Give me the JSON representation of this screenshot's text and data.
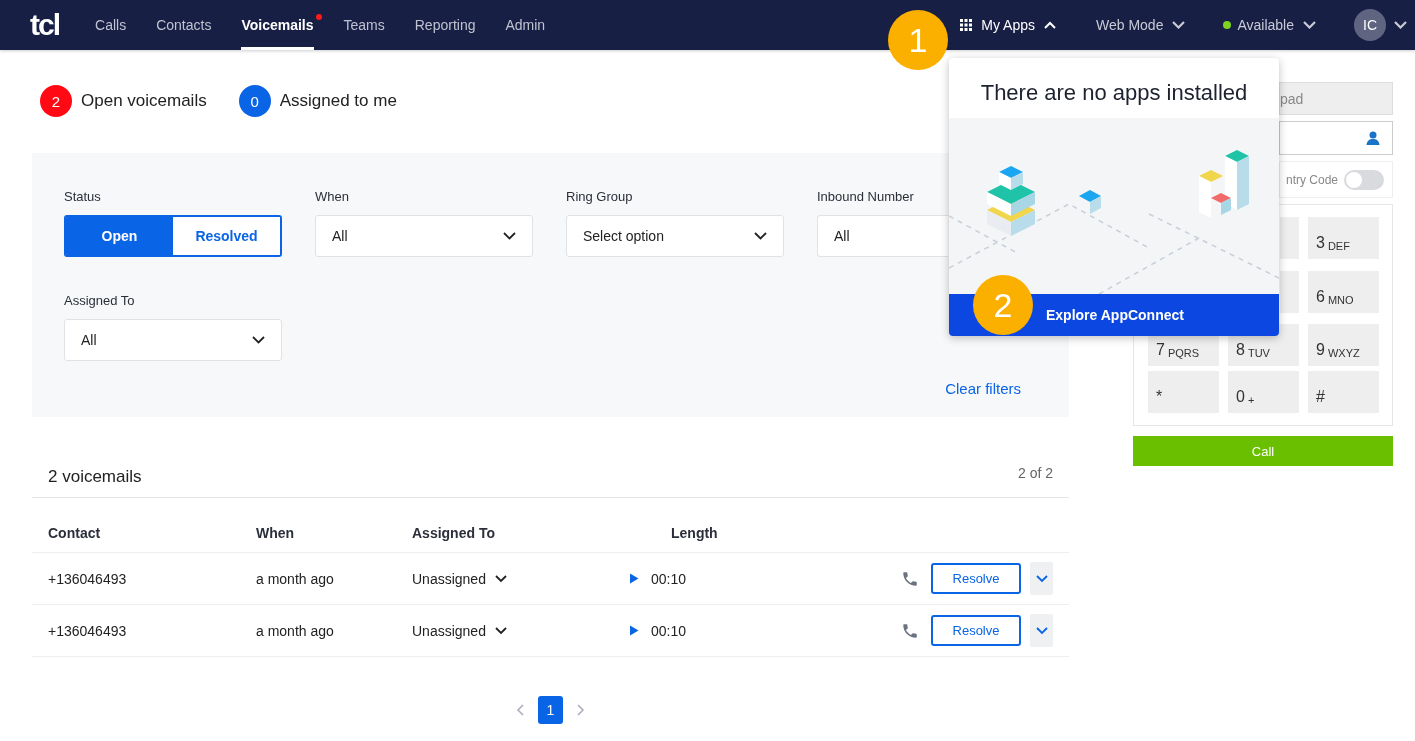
{
  "nav": {
    "logo": "tcl",
    "items": [
      {
        "label": "Calls",
        "selected": false,
        "notification": false
      },
      {
        "label": "Contacts",
        "selected": false,
        "notification": false
      },
      {
        "label": "Voicemails",
        "selected": true,
        "notification": true
      },
      {
        "label": "Teams",
        "selected": false,
        "notification": false
      },
      {
        "label": "Reporting",
        "selected": false,
        "notification": false
      },
      {
        "label": "Admin",
        "selected": false,
        "notification": false
      }
    ],
    "my_apps": {
      "label": "My Apps",
      "expanded": true
    },
    "mode": {
      "label": "Web Mode"
    },
    "status": {
      "label": "Available",
      "color": "#7ed321"
    },
    "avatar": {
      "initials": "IC"
    }
  },
  "stats": [
    {
      "count": "2",
      "label": "Open voicemails",
      "color": "#ff0a14"
    },
    {
      "count": "0",
      "label": "Assigned to me",
      "color": "#0a64e6"
    }
  ],
  "filters": {
    "fields": [
      {
        "kind": "toggle",
        "label": "Status",
        "options": [
          {
            "label": "Open",
            "selected": true
          },
          {
            "label": "Resolved",
            "selected": false
          }
        ]
      },
      {
        "kind": "select",
        "label": "When",
        "value": "All"
      },
      {
        "kind": "select",
        "label": "Ring Group",
        "value": "Select option"
      },
      {
        "kind": "select-covered",
        "label": "Inbound Number",
        "value": "All"
      },
      {
        "kind": "select",
        "label": "Assigned To",
        "value": "All"
      }
    ],
    "clear": "Clear filters"
  },
  "table": {
    "title": "2 voicemails",
    "range": "2 of 2",
    "columns": [
      "Contact",
      "When",
      "Assigned To",
      "Length"
    ],
    "rows": [
      {
        "contact": "+136046493",
        "when": "a month ago",
        "assigned": "Unassigned",
        "length": "00:10",
        "action": "Resolve"
      },
      {
        "contact": "+136046493",
        "when": "a month ago",
        "assigned": "Unassigned",
        "length": "00:10",
        "action": "Resolve"
      }
    ]
  },
  "pagination": {
    "pages": [
      {
        "label": "1",
        "selected": true
      }
    ]
  },
  "dialer": {
    "number_placeholder": "pad",
    "country_code": {
      "label": "ntry Code",
      "on": false
    },
    "keypad": [
      [
        {
          "kind": "covered"
        },
        {
          "kind": "partial"
        },
        {
          "kind": "key",
          "digit": "3",
          "letters": "DEF"
        }
      ],
      [
        {
          "kind": "covered"
        },
        {
          "kind": "partial"
        },
        {
          "kind": "key",
          "digit": "6",
          "letters": "MNO"
        }
      ],
      [
        {
          "kind": "key",
          "digit": "7",
          "letters": "PQRS"
        },
        {
          "kind": "key",
          "digit": "8",
          "letters": "TUV"
        },
        {
          "kind": "key",
          "digit": "9",
          "letters": "WXYZ"
        }
      ],
      [
        {
          "kind": "key",
          "digit": "*"
        },
        {
          "kind": "key",
          "digit": "0",
          "letters": "+"
        },
        {
          "kind": "key",
          "digit": "#"
        }
      ]
    ],
    "call": "Call"
  },
  "apps_popup": {
    "title": "There are no apps installed",
    "action": "Explore AppConnect"
  },
  "callouts": [
    "1",
    "2"
  ]
}
